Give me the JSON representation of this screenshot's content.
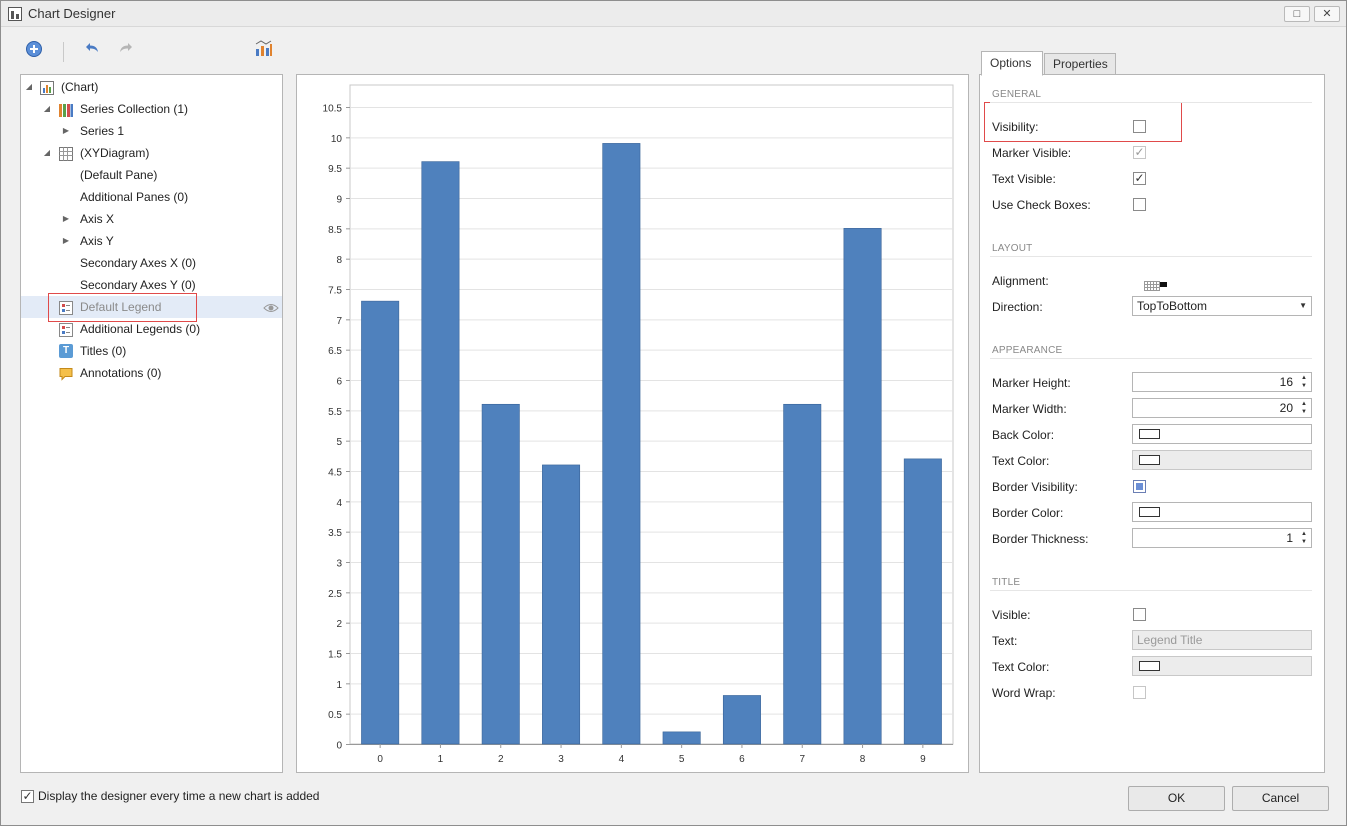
{
  "window": {
    "title": "Chart Designer",
    "maximize_glyph": "□",
    "close_glyph": "✕"
  },
  "toolbar": {
    "icons": [
      "add-icon",
      "undo-icon",
      "redo-icon",
      "chart-wizard-icon"
    ]
  },
  "tree": {
    "items": [
      {
        "label": "(Chart)",
        "icon": "chart-icon",
        "expanded": true
      },
      {
        "label": "Series Collection (1)",
        "icon": "series-collection-icon",
        "expanded": true
      },
      {
        "label": "Series 1",
        "icon": "",
        "expanded": false
      },
      {
        "label": "(XYDiagram)",
        "icon": "diagram-icon",
        "expanded": true
      },
      {
        "label": "(Default Pane)",
        "icon": ""
      },
      {
        "label": "Additional Panes (0)",
        "icon": ""
      },
      {
        "label": "Axis X",
        "icon": "",
        "expanded": false
      },
      {
        "label": "Axis Y",
        "icon": "",
        "expanded": false
      },
      {
        "label": "Secondary Axes X (0)",
        "icon": ""
      },
      {
        "label": "Secondary Axes Y (0)",
        "icon": ""
      },
      {
        "label": "Default Legend",
        "icon": "legend-icon",
        "selected": true
      },
      {
        "label": "Additional Legends (0)",
        "icon": "legend-icon"
      },
      {
        "label": "Titles (0)",
        "icon": "titles-icon",
        "icon_text": "T"
      },
      {
        "label": "Annotations (0)",
        "icon": "annotation-icon"
      }
    ]
  },
  "chart_data": {
    "type": "bar",
    "categories": [
      "0",
      "1",
      "2",
      "3",
      "4",
      "5",
      "6",
      "7",
      "8",
      "9"
    ],
    "series": [
      {
        "values": [
          7.3,
          9.6,
          5.6,
          4.6,
          9.9,
          0.2,
          0.8,
          5.6,
          8.5,
          4.7
        ]
      }
    ],
    "ylim": [
      0,
      10.5
    ],
    "yticks": [
      "0",
      "0.5",
      "1",
      "1.5",
      "2",
      "2.5",
      "3",
      "3.5",
      "4",
      "4.5",
      "5",
      "5.5",
      "6",
      "6.5",
      "7",
      "7.5",
      "8",
      "8.5",
      "9",
      "9.5",
      "10",
      "10.5"
    ],
    "ytick_values": [
      0,
      0.5,
      1,
      1.5,
      2,
      2.5,
      3,
      3.5,
      4,
      4.5,
      5,
      5.5,
      6,
      6.5,
      7,
      7.5,
      8,
      8.5,
      9,
      9.5,
      10,
      10.5
    ],
    "bar_color": "#4f81bd",
    "grid": true,
    "legend": "none"
  },
  "options": {
    "tabs": [
      "Options",
      "Properties"
    ],
    "active_tab": "Options",
    "general": {
      "title": "GENERAL",
      "visibility_label": "Visibility:",
      "visibility_checked": false,
      "marker_visible_label": "Marker Visible:",
      "marker_visible_checked": true,
      "text_visible_label": "Text Visible:",
      "text_visible_checked": true,
      "use_check_boxes_label": "Use Check Boxes:",
      "use_check_boxes_checked": false
    },
    "layout": {
      "title": "LAYOUT",
      "alignment_label": "Alignment:",
      "direction_label": "Direction:",
      "direction_value": "TopToBottom"
    },
    "appearance": {
      "title": "APPEARANCE",
      "marker_height_label": "Marker Height:",
      "marker_height_value": "16",
      "marker_width_label": "Marker Width:",
      "marker_width_value": "20",
      "back_color_label": "Back Color:",
      "text_color_label": "Text Color:",
      "border_visibility_label": "Border Visibility:",
      "border_color_label": "Border Color:",
      "border_thickness_label": "Border Thickness:",
      "border_thickness_value": "1"
    },
    "title_section": {
      "title": "TITLE",
      "visible_label": "Visible:",
      "visible_checked": false,
      "text_label": "Text:",
      "text_placeholder": "Legend Title",
      "text_color_label": "Text Color:",
      "word_wrap_label": "Word Wrap:"
    }
  },
  "footer": {
    "display_designer_label": "Display the designer every time a new chart is added",
    "display_designer_checked": true,
    "check_glyph": "✓",
    "ok_label": "OK",
    "cancel_label": "Cancel"
  },
  "colors": {
    "accent_red": "#e04a4a",
    "selection": "#e3ebf7",
    "bar": "#4f81bd"
  }
}
